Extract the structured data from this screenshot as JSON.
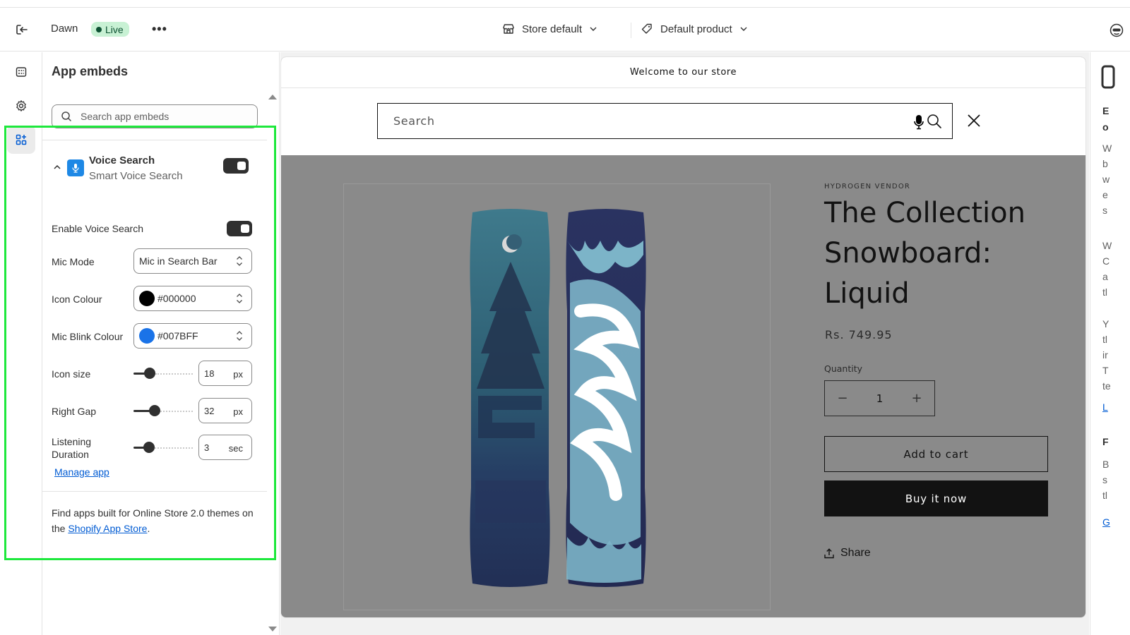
{
  "topbar": {
    "theme_name": "Dawn",
    "status_badge": "Live",
    "more_label": "•••",
    "store_context": "Store default",
    "template_context": "Default product"
  },
  "sidebar": {
    "title": "App embeds",
    "search_placeholder": "Search app embeds",
    "app": {
      "name": "Voice Search",
      "subtitle": "Smart Voice Search",
      "enabled": true,
      "settings": {
        "enable_label": "Enable Voice Search",
        "enable_value": true,
        "mic_mode_label": "Mic Mode",
        "mic_mode_value": "Mic in Search Bar",
        "icon_colour_label": "Icon Colour",
        "icon_colour_value": "#000000",
        "blink_colour_label": "Mic Blink Colour",
        "blink_colour_value": "#007BFF",
        "icon_size_label": "Icon size",
        "icon_size_value": "18",
        "icon_size_unit": "px",
        "icon_size_level": 0.22,
        "right_gap_label": "Right Gap",
        "right_gap_value": "32",
        "right_gap_unit": "px",
        "right_gap_level": 0.32,
        "listening_label_1": "Listening",
        "listening_label_2": "Duration",
        "listening_value": "3",
        "listening_unit": "sec",
        "listening_level": 0.2
      },
      "manage_link": "Manage app"
    },
    "footer_text": "Find apps built for Online Store 2.0 themes on the ",
    "footer_link": "Shopify App Store",
    "footer_end": "."
  },
  "preview": {
    "announcement": "Welcome to our store",
    "search_placeholder": "Search",
    "vendor": "HYDROGEN VENDOR",
    "product_title": "The Collection Snowboard: Liquid",
    "price": "Rs. 749.95",
    "quantity_label": "Quantity",
    "quantity_value": "1",
    "minus": "−",
    "plus": "+",
    "add_to_cart": "Add to cart",
    "buy_now": "Buy it now",
    "share": "Share"
  },
  "right_panel": {
    "fragments": [
      "E",
      "o",
      "W",
      "b",
      "w",
      "e",
      "s",
      "W",
      "C",
      "a",
      "tl",
      "Y",
      "tl",
      "ir",
      "T",
      "te",
      "L",
      "F",
      "B",
      "s",
      "tl",
      "G"
    ]
  },
  "colors": {
    "highlight": "#1EE83C",
    "live_bg": "#C8F1D4",
    "link": "#005BD3",
    "icon_colour": "#000000",
    "blink_colour": "#007BFF"
  }
}
